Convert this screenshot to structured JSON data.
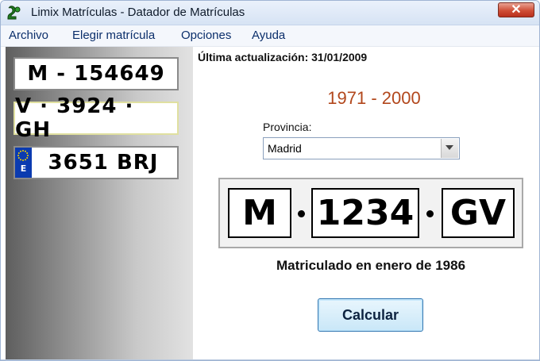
{
  "window": {
    "title": "Limix Matrículas - Datador de Matrículas",
    "close_glyph": "✕"
  },
  "menu": [
    "Archivo",
    "Elegir matrícula",
    "Opciones",
    "Ayuda"
  ],
  "sidebar": {
    "plates": [
      {
        "text": "M - 154649",
        "style": "old"
      },
      {
        "text": "V · 3924 · GH",
        "style": "intermediate"
      },
      {
        "text": "3651 BRJ",
        "style": "current",
        "eu_letter": "E"
      }
    ]
  },
  "main": {
    "last_update": "Última actualización: 31/01/2009",
    "year_range": "1971 - 2000",
    "province_label": "Provincia:",
    "province_value": "Madrid",
    "plate": {
      "prefix": "M",
      "number": "1234",
      "suffix": "GV"
    },
    "result": "Matriculado en enero de 1986",
    "calculate_label": "Calcular"
  },
  "colors": {
    "year_range": "#b2471c",
    "button_border": "#2f75b0",
    "eu_blue": "#0b3bb0"
  }
}
